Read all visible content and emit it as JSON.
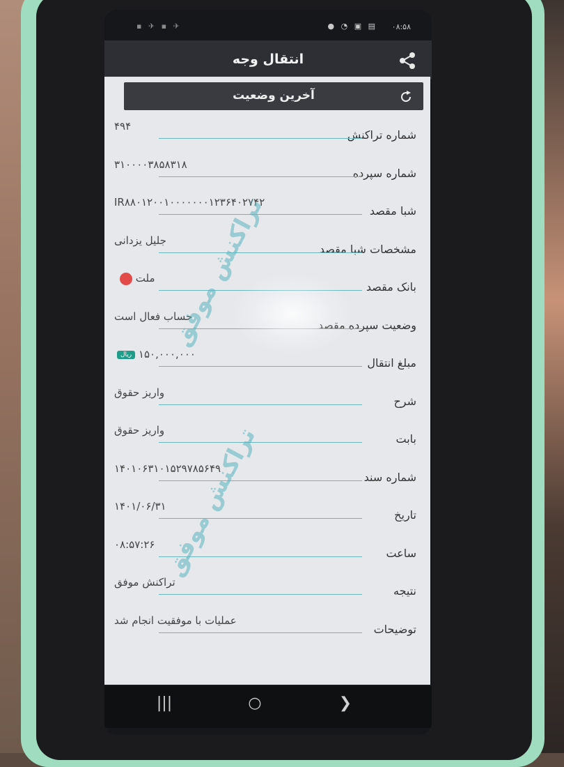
{
  "status_bar": {
    "time": "۰۸:۵۸",
    "icons_left": "▪ ✈ ▪ ✈",
    "icons_right": "● ◔ ▣ ▤"
  },
  "app": {
    "title": "انتقال وجه",
    "share_icon": "share-icon"
  },
  "section": {
    "title": "آخرین وضعیت",
    "refresh_icon": "refresh-icon"
  },
  "rows": [
    {
      "label": "شماره تراکنش",
      "value": "۴۹۴"
    },
    {
      "label": "شماره سپرده",
      "value": "۳۱۰۰۰۰۳۸۵۸۳۱۸"
    },
    {
      "label": "شبا مقصد",
      "value": "IR۸۸۰۱۲۰۰۱۰۰۰۰۰۰۰۱۲۳۶۴۰۲۷۴۲"
    },
    {
      "label": "مشخصات شبا مقصد",
      "value": "جلیل یزدانی"
    },
    {
      "label": "بانک مقصد",
      "value": "ملت"
    },
    {
      "label": "وضعیت سپرده مقصد",
      "value": "حساب فعال است"
    },
    {
      "label": "مبلغ انتقال",
      "value": "۱۵۰,۰۰۰,۰۰۰",
      "badge": "ریال"
    },
    {
      "label": "شرح",
      "value": "واریز حقوق"
    },
    {
      "label": "بابت",
      "value": "واریز حقوق"
    },
    {
      "label": "شماره سند",
      "value": "۱۴۰۱۰۶۳۱۰۱۵۲۹۷۸۵۶۴۹"
    },
    {
      "label": "تاریخ",
      "value": "۱۴۰۱/۰۶/۳۱"
    },
    {
      "label": "ساعت",
      "value": "۰۸:۵۷:۲۶"
    },
    {
      "label": "نتیجه",
      "value": "تراکنش موفق"
    },
    {
      "label": "توضیحات",
      "value": "عملیات با موفقیت انجام شد"
    }
  ],
  "watermarks": [
    "تراکنش موفق",
    "تراکنش موفق"
  ],
  "navbar": {
    "recent": "|||",
    "home": "○",
    "back": "❯"
  },
  "colors": {
    "accent_line": "#6ab6bb",
    "badge": "#1f9c8a",
    "appbar": "#2e2f35"
  }
}
